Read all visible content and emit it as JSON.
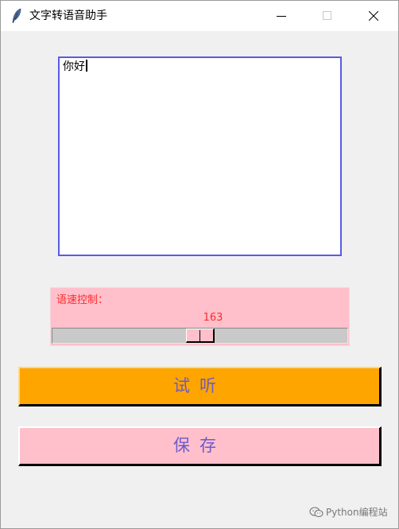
{
  "window": {
    "title": "文字转语音助手"
  },
  "text_area": {
    "value": "你好"
  },
  "speed": {
    "label": "语速控制：",
    "value": "163",
    "fraction": 0.5
  },
  "buttons": {
    "listen_label": "试听",
    "save_label": "保存"
  },
  "watermark": {
    "text": "Python编程站"
  },
  "colors": {
    "text_border": "#5a5ae6",
    "speed_frame_bg": "#ffc0cb",
    "speed_text": "#ff2a2a",
    "listen_bg": "#ffa500",
    "save_bg": "#ffc0cb",
    "button_text": "#6a5acd"
  },
  "icons": {
    "app": "feather-icon",
    "minimize": "minimize-icon",
    "maximize": "maximize-icon",
    "close": "close-icon",
    "watermark": "wechat-icon"
  }
}
